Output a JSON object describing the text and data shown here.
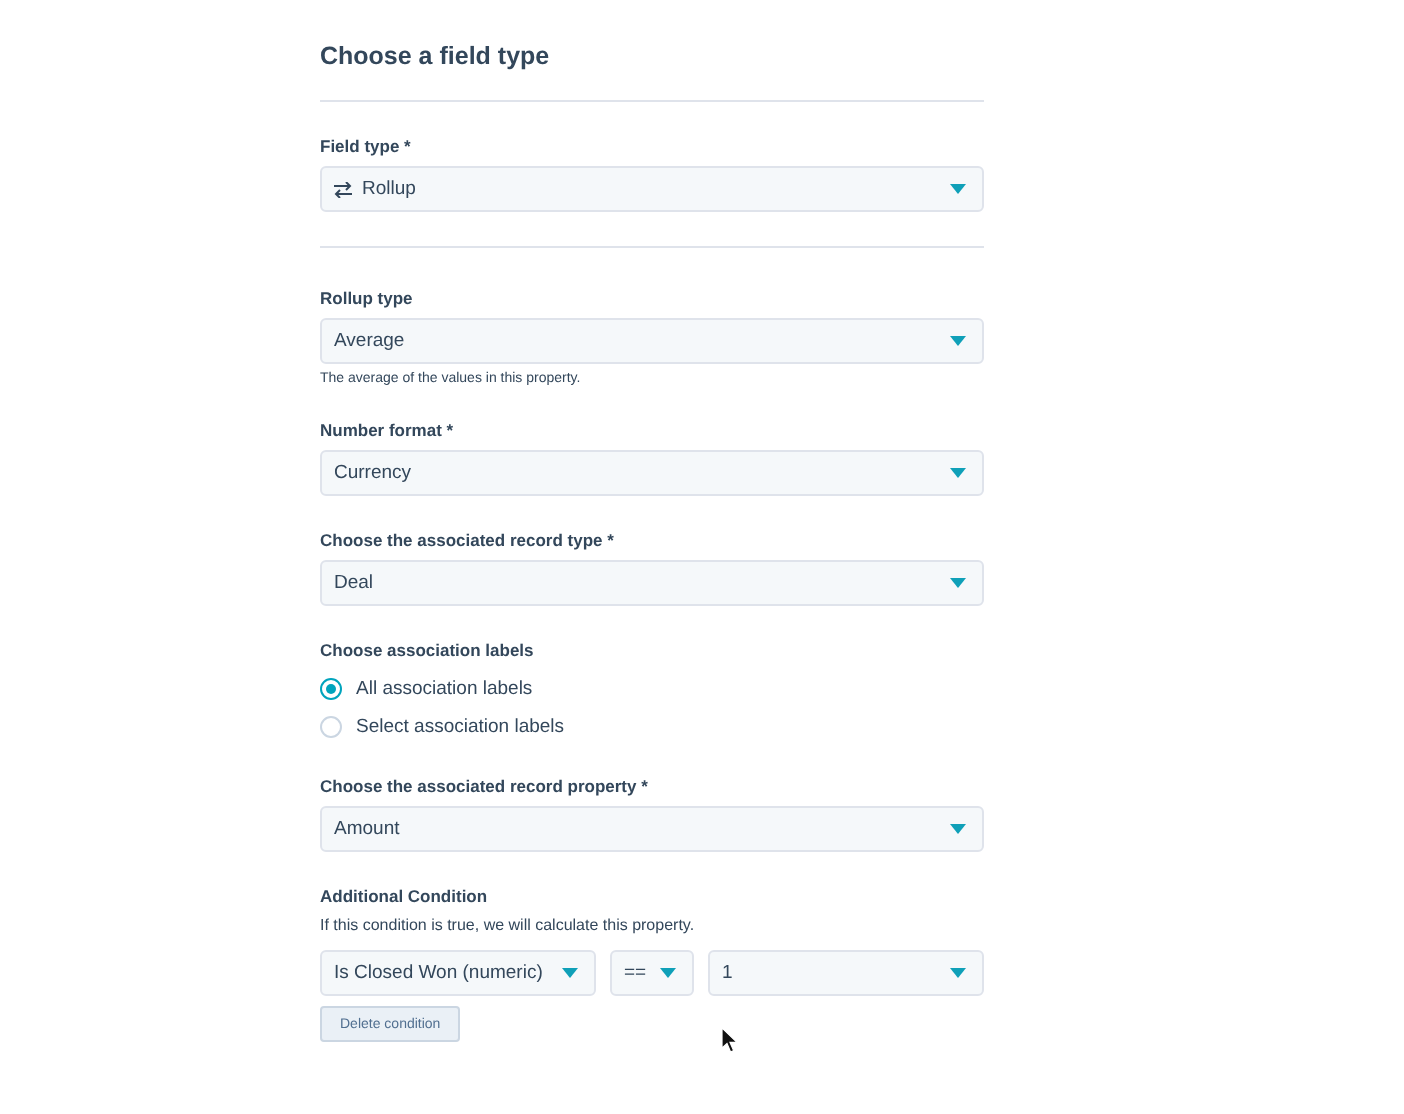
{
  "title": "Choose a field type",
  "fields": [
    {
      "kind": "divider"
    },
    {
      "kind": "select",
      "label": "Field type *",
      "value": "Rollup",
      "icon": true
    },
    {
      "kind": "divider"
    },
    {
      "kind": "select",
      "label": "Rollup type",
      "value": "Average",
      "help": "The average of the values in this property."
    },
    {
      "kind": "select",
      "label": "Number format *",
      "value": "Currency"
    },
    {
      "kind": "select",
      "label": "Choose the associated record type *",
      "value": "Deal"
    },
    {
      "kind": "radio",
      "label": "Choose association labels",
      "options": [
        {
          "label": "All association labels",
          "selected": true
        },
        {
          "label": "Select association labels",
          "selected": false
        }
      ]
    },
    {
      "kind": "select",
      "label": "Choose the associated record property *",
      "value": "Amount"
    },
    {
      "kind": "condition",
      "label": "Additional Condition",
      "help": "If this condition is true, we will calculate this property.",
      "selects": [
        "Is Closed Won (numeric)",
        "==",
        "1"
      ],
      "button": "Delete condition"
    }
  ]
}
